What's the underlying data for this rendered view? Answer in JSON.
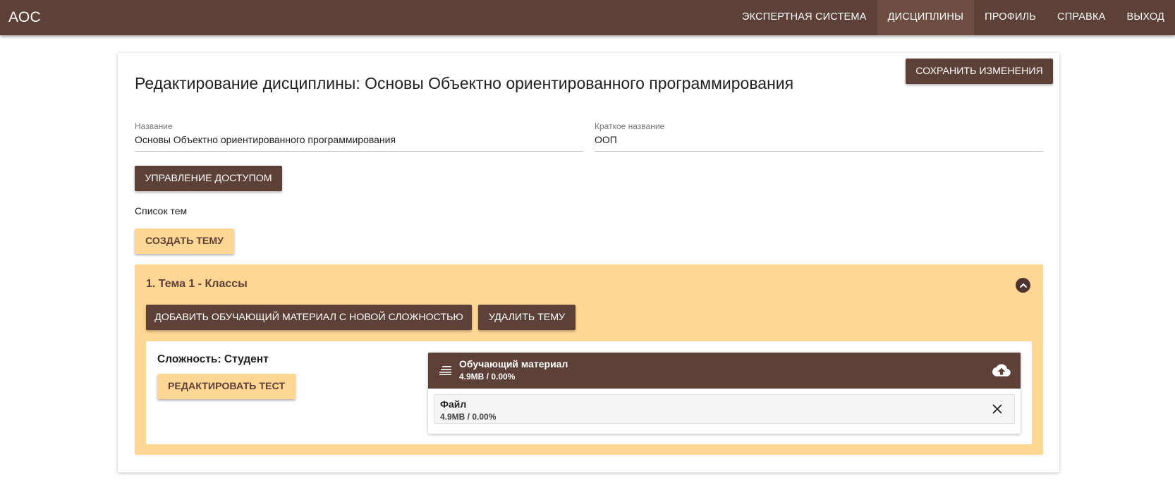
{
  "app": {
    "brand": "АОС"
  },
  "nav": {
    "items": [
      {
        "label": "ЭКСПЕРТНАЯ СИСТЕМА"
      },
      {
        "label": "ДИСЦИПЛИНЫ",
        "active": true
      },
      {
        "label": "ПРОФИЛЬ"
      },
      {
        "label": "СПРАВКА"
      },
      {
        "label": "ВЫХОД"
      }
    ]
  },
  "page": {
    "title": "Редактирование дисциплины: Основы Объектно ориентированного программирования",
    "save_label": "СОХРАНИТЬ ИЗМЕНЕНИЯ"
  },
  "form": {
    "name": {
      "label": "Название",
      "value": "Основы Объектно ориентированного программирования"
    },
    "short_name": {
      "label": "Краткое название",
      "value": "ООП"
    }
  },
  "access_label": "УПРАВЛЕНИЕ ДОСТУПОМ",
  "topics_label": "Список тем",
  "create_topic_label": "СОЗДАТЬ ТЕМУ",
  "topic": {
    "title": "1. Тема 1 - Классы",
    "add_material_label": "ДОБАВИТЬ ОБУЧАЮЩИЙ МАТЕРИАЛ С НОВОЙ СЛОЖНОСТЬЮ",
    "delete_label": "УДАЛИТЬ ТЕМУ",
    "level": {
      "title": "Сложность: Студент",
      "edit_test_label": "РЕДАКТИРОВАТЬ ТЕСТ"
    },
    "uploader": {
      "title": "Обучающий материал",
      "progress": "4.9MB / 0.00%",
      "file": {
        "name": "Файл",
        "progress": "4.9MB / 0.00%"
      }
    }
  },
  "colors": {
    "primary": "#5d4037",
    "accent": "#ffd794",
    "nav_active": "#6d4c41"
  },
  "icons": {
    "collapse": "chevron-up-icon",
    "menu": "menu-icon",
    "upload": "cloud-upload-icon",
    "close": "close-icon"
  }
}
